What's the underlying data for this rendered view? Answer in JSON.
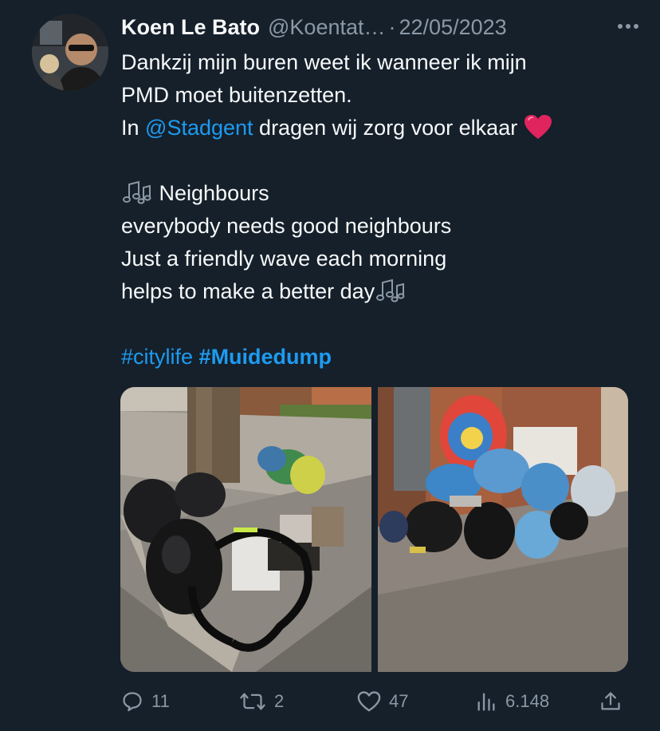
{
  "tweet": {
    "author_name": "Koen Le Bato",
    "handle": "@Koentat…",
    "separator": "·",
    "date": "22/05/2023",
    "text_line_1": "Dankzij mijn buren weet ik wanneer ik mijn",
    "text_line_2": "PMD moet buitenzetten.",
    "text_line_3_prefix": "In ",
    "mention": "@Stadgent",
    "text_line_3_suffix": " dragen wij zorg voor elkaar",
    "song_line_1": " Neighbours",
    "song_line_2": "everybody needs good neighbours",
    "song_line_3": "Just a friendly wave each morning",
    "song_line_4": "helps to make a better day",
    "hashtag_1": "#citylife",
    "hashtag_2": "#Muidedump"
  },
  "actions": {
    "replies": "11",
    "retweets": "2",
    "likes": "47",
    "views": "6.148"
  },
  "icons": [
    "more-icon",
    "heart-emoji",
    "music-notes-icon",
    "reply-icon",
    "retweet-icon",
    "like-icon",
    "views-icon",
    "share-icon"
  ],
  "colors": {
    "background": "#15202b",
    "text": "#f7f9f9",
    "secondary": "#8b98a5",
    "link": "#1d9bf0",
    "heart": "#e0245e"
  }
}
